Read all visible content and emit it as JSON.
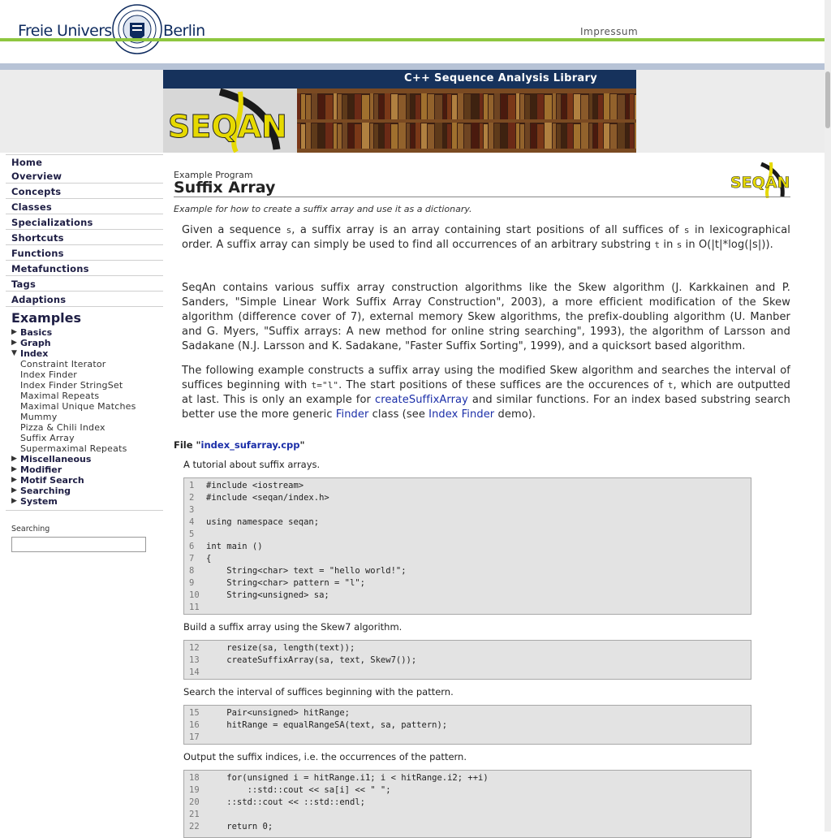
{
  "header": {
    "fu_left": "Freie Universität",
    "fu_right": "Berlin",
    "impressum": "Impressum"
  },
  "banner": {
    "title": "C++ Sequence Analysis Library"
  },
  "sidebar": {
    "nav": [
      "Home",
      "Overview",
      "Concepts",
      "Classes",
      "Specializations",
      "Shortcuts",
      "Functions",
      "Metafunctions",
      "Tags",
      "Adaptions"
    ],
    "examples_heading": "Examples",
    "tree": [
      {
        "label": "Basics",
        "expanded": false
      },
      {
        "label": "Graph",
        "expanded": false
      },
      {
        "label": "Index",
        "expanded": true
      }
    ],
    "index_children": [
      "Constraint Iterator",
      "Index Finder",
      "Index Finder StringSet",
      "Maximal Repeats",
      "Maximal Unique Matches",
      "Mummy",
      "Pizza & Chili Index",
      "Suffix Array",
      "Supermaximal Repeats"
    ],
    "tree_after": [
      "Miscellaneous",
      "Modifier",
      "Motif Search",
      "Searching",
      "System"
    ],
    "search_label": "Searching",
    "search_value": ""
  },
  "content": {
    "example_label": "Example Program",
    "title": "Suffix Array",
    "subtitle": "Example for how to create a suffix array and use it as a dictionary.",
    "p1": [
      "Given a sequence ",
      "s",
      ", a suffix array is an array containing start positions of all suffices of ",
      "s",
      " in lexicographical order. A suffix array can simply be used to find all occurrences of an arbitrary substring ",
      "t",
      " in ",
      "s",
      " in O(|t|*log(|s|))."
    ],
    "p2": "SeqAn contains various suffix array construction algorithms like the Skew algorithm (J. Karkkainen and P. Sanders, \"Simple Linear Work Suffix Array Construction\", 2003), a more efficient modification of the Skew algorithm (difference cover of 7), external memory Skew algorithms, the prefix-doubling algorithm (U. Manber and G. Myers, \"Suffix arrays: A new method for online string searching\", 1993), the algorithm of Larsson and Sadakane (N.J. Larsson and K. Sadakane, \"Faster Suffix Sorting\", 1999), and a quicksort based algorithm.",
    "p3": [
      "The following example constructs a suffix array using the modified Skew algorithm and searches the interval of suffices beginning with ",
      "t=\"l\"",
      ". The start positions of these suffices are the occurences of ",
      "t",
      ", which are outputted at last. This is only an example for ",
      "createSuffixArray",
      " and similar functions. For an index based substring search better use the more generic ",
      "Finder",
      " class (see ",
      "Index Finder",
      " demo)."
    ],
    "file_prefix": "File \"",
    "file_name": "index_sufarray.cpp",
    "file_suffix": "\"",
    "captions": [
      "A tutorial about suffix arrays.",
      "Build a suffix array using the Skew7 algorithm.",
      "Search the interval of suffices beginning with the pattern.",
      "Output the suffix indices, i.e. the occurrences of the pattern."
    ],
    "code_blocks": [
      [
        [
          "1",
          "#include <iostream>"
        ],
        [
          "2",
          "#include <seqan/index.h>"
        ],
        [
          "3",
          ""
        ],
        [
          "4",
          "using namespace seqan;"
        ],
        [
          "5",
          ""
        ],
        [
          "6",
          "int main ()"
        ],
        [
          "7",
          "{"
        ],
        [
          "8",
          "    String<char> text = \"hello world!\";"
        ],
        [
          "9",
          "    String<char> pattern = \"l\";"
        ],
        [
          "10",
          "    String<unsigned> sa;"
        ],
        [
          "11",
          ""
        ]
      ],
      [
        [
          "12",
          "    resize(sa, length(text));"
        ],
        [
          "13",
          "    createSuffixArray(sa, text, Skew7());"
        ],
        [
          "14",
          ""
        ]
      ],
      [
        [
          "15",
          "    Pair<unsigned> hitRange;"
        ],
        [
          "16",
          "    hitRange = equalRangeSA(text, sa, pattern);"
        ],
        [
          "17",
          ""
        ]
      ],
      [
        [
          "18",
          "    for(unsigned i = hitRange.i1; i < hitRange.i2; ++i)"
        ],
        [
          "19",
          "        ::std::cout << sa[i] << \" \";"
        ],
        [
          "20",
          "    ::std::cout << ::std::endl;"
        ],
        [
          "21",
          ""
        ],
        [
          "22",
          "    return 0;"
        ]
      ]
    ]
  }
}
